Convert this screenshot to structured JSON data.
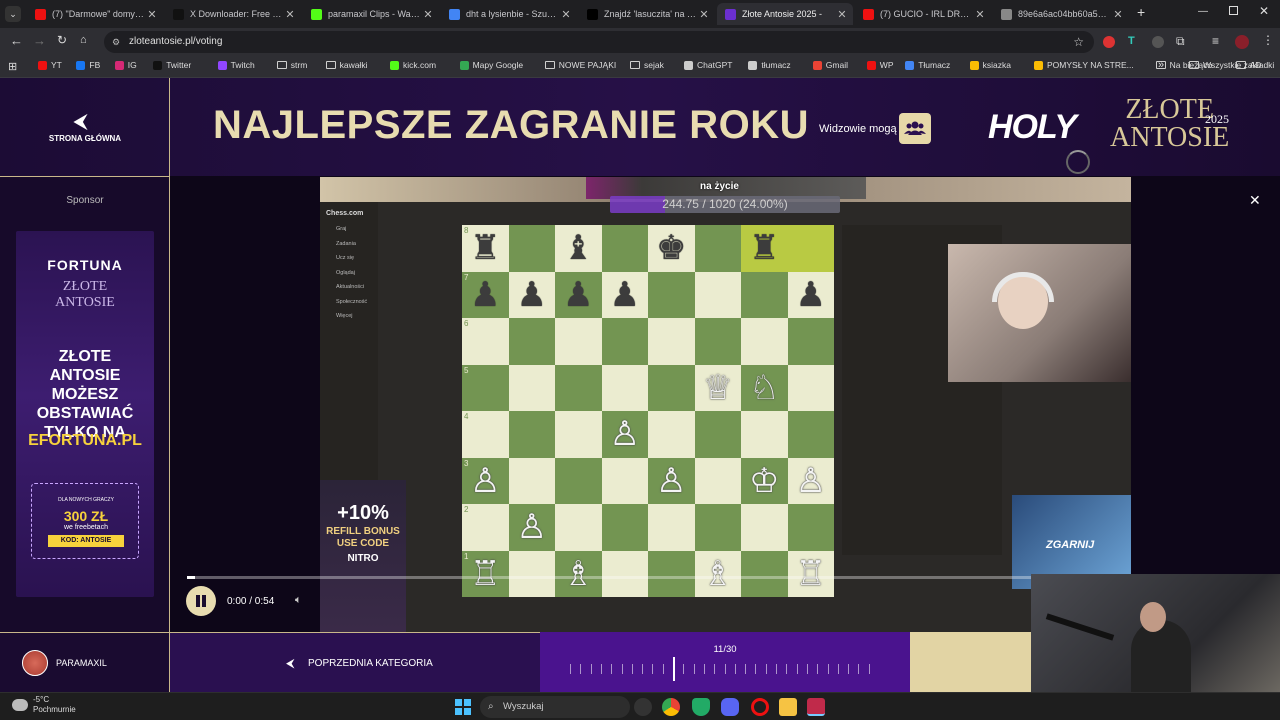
{
  "browser": {
    "tabs": [
      {
        "title": "(7) \"Darmowe\" domy w Ja",
        "fav_color": "#e11"
      },
      {
        "title": "X Downloader: Free Twitt",
        "fav_color": "#111"
      },
      {
        "title": "paramaxil Clips - Watch L",
        "fav_color": "#53fc18"
      },
      {
        "title": "dht a lysienbie - Szukaj w",
        "fav_color": "#4285f4"
      },
      {
        "title": "Znajdź 'lasuczita' na TikTo",
        "fav_color": "#000"
      },
      {
        "title": "Złote Antosie 2025 - ",
        "fav_color": "#6b2fd0",
        "active": true
      },
      {
        "title": "(7) GUCIO - IRL DRUNK S",
        "fav_color": "#e11"
      },
      {
        "title": "89e6a6ac04bb60a51f06b",
        "fav_color": "#888"
      }
    ],
    "new_tab": "+",
    "url": "zloteantosie.pl/voting",
    "bookmarks": [
      {
        "label": "YT",
        "type": "icon",
        "color": "#e11"
      },
      {
        "label": "FB",
        "type": "icon",
        "color": "#1877f2"
      },
      {
        "label": "IG",
        "type": "icon",
        "color": "#d62976"
      },
      {
        "label": "Twitter",
        "type": "icon",
        "color": "#111"
      },
      {
        "label": "Twitch",
        "type": "icon",
        "color": "#9146ff"
      },
      {
        "label": "strm",
        "type": "folder"
      },
      {
        "label": "kawałki",
        "type": "folder"
      },
      {
        "label": "kick.com",
        "type": "icon",
        "color": "#53fc18"
      },
      {
        "label": "Mapy Google",
        "type": "icon",
        "color": "#34a853"
      },
      {
        "label": "NOWE PAJĄKI",
        "type": "folder"
      },
      {
        "label": "sejak",
        "type": "folder"
      },
      {
        "label": "ChatGPT",
        "type": "icon",
        "color": "#ccc"
      },
      {
        "label": "tłumacz",
        "type": "icon",
        "color": "#ccc"
      },
      {
        "label": "Gmail",
        "type": "icon",
        "color": "#ea4335"
      },
      {
        "label": "WP",
        "type": "icon",
        "color": "#e11"
      },
      {
        "label": "Tłumacz",
        "type": "icon",
        "color": "#4285f4"
      },
      {
        "label": "ksiazka",
        "type": "icon",
        "color": "#fbbc04"
      },
      {
        "label": "POMYSŁY NA STRE...",
        "type": "icon",
        "color": "#fbbc04"
      },
      {
        "label": "Na bieżąco",
        "type": "folder"
      },
      {
        "label": "AD",
        "type": "folder"
      }
    ],
    "all_bookmarks": "Wszystkie zakładki"
  },
  "page": {
    "home_label": "STRONA GŁÓWNA",
    "category_title": "NAJLEPSZE ZAGRANIE ROKU",
    "viewers_label": "Widzowie mogą",
    "logo_holy": "HOLY",
    "logo_zlote": "ZŁOTE",
    "logo_antosie": "ANTOSIE",
    "logo_year": "2025",
    "sponsor_label": "Sponsor",
    "ad": {
      "brand": "FORTUNA",
      "logo_line1": "ZŁOTE",
      "logo_line2": "ANTOSIE",
      "headline": "ZŁOTE ANTOSIE MOŻESZ OBSTAWIAĆ TYLKO NA",
      "site": "EFORTUNA.PL",
      "promo_small": "DLA NOWYCH GRACZY",
      "promo_amount": "300 ZŁ",
      "promo_sub": "we freebetach",
      "promo_code": "KOD: ANTOSIE"
    },
    "video": {
      "stream_goal_name": "na życie",
      "stream_goal": "244.75 / 1020 (24.00%)",
      "stream_goal_fraction": 0.24,
      "left_ad_bonus": "+10%",
      "left_ad_line1": "REFILL BONUS",
      "left_ad_line2": "USE CODE",
      "left_ad_code": "NITRO",
      "right_ad_text": "ZGARNIJ",
      "time": "0:00 / 0:54",
      "progress_fraction": 0.01
    },
    "username": "PARAMAXIL",
    "prev_category": "POPRZEDNIA KATEGORIA",
    "pager": "11/30",
    "pager_fraction": 0.367
  },
  "chess": {
    "pieces": [
      {
        "sq": "a8",
        "glyph": "♜",
        "side": "b"
      },
      {
        "sq": "c8",
        "glyph": "♝",
        "side": "b"
      },
      {
        "sq": "e8",
        "glyph": "♚",
        "side": "b"
      },
      {
        "sq": "g8",
        "glyph": "♜",
        "side": "b"
      },
      {
        "sq": "a7",
        "glyph": "♟",
        "side": "b"
      },
      {
        "sq": "b7",
        "glyph": "♟",
        "side": "b"
      },
      {
        "sq": "c7",
        "glyph": "♟",
        "side": "b"
      },
      {
        "sq": "d7",
        "glyph": "♟",
        "side": "b"
      },
      {
        "sq": "h7",
        "glyph": "♟",
        "side": "b"
      },
      {
        "sq": "f5",
        "glyph": "♕",
        "side": "w"
      },
      {
        "sq": "g5",
        "glyph": "♘",
        "side": "w"
      },
      {
        "sq": "d4",
        "glyph": "♙",
        "side": "w"
      },
      {
        "sq": "a3",
        "glyph": "♙",
        "side": "w"
      },
      {
        "sq": "e3",
        "glyph": "♙",
        "side": "w"
      },
      {
        "sq": "g3",
        "glyph": "♔",
        "side": "w"
      },
      {
        "sq": "h3",
        "glyph": "♙",
        "side": "w"
      },
      {
        "sq": "b2",
        "glyph": "♙",
        "side": "w"
      },
      {
        "sq": "a1",
        "glyph": "♖",
        "side": "w"
      },
      {
        "sq": "c1",
        "glyph": "♗",
        "side": "w"
      },
      {
        "sq": "f1",
        "glyph": "♗",
        "side": "w"
      },
      {
        "sq": "h1",
        "glyph": "♖",
        "side": "w"
      }
    ],
    "highlight": [
      "g8",
      "h8"
    ],
    "ranks": [
      "8",
      "7",
      "6",
      "5",
      "4",
      "3",
      "2",
      "1"
    ],
    "files": [
      "a",
      "b",
      "c",
      "d",
      "e",
      "f",
      "g",
      "h"
    ],
    "nav_items": [
      "Graj",
      "Zadania",
      "Ucz się",
      "Oglądaj",
      "Aktualności",
      "Społeczność",
      "Więcej"
    ],
    "site": "Chess.com"
  },
  "taskbar": {
    "temp": "-5°C",
    "weather": "Pochmurnie",
    "search": "Wyszukaj"
  },
  "colors": {
    "light_square": "#ebecd0",
    "dark_square": "#739552",
    "highlight": "#b9ca43",
    "accent_gold": "#e8dcb0"
  }
}
